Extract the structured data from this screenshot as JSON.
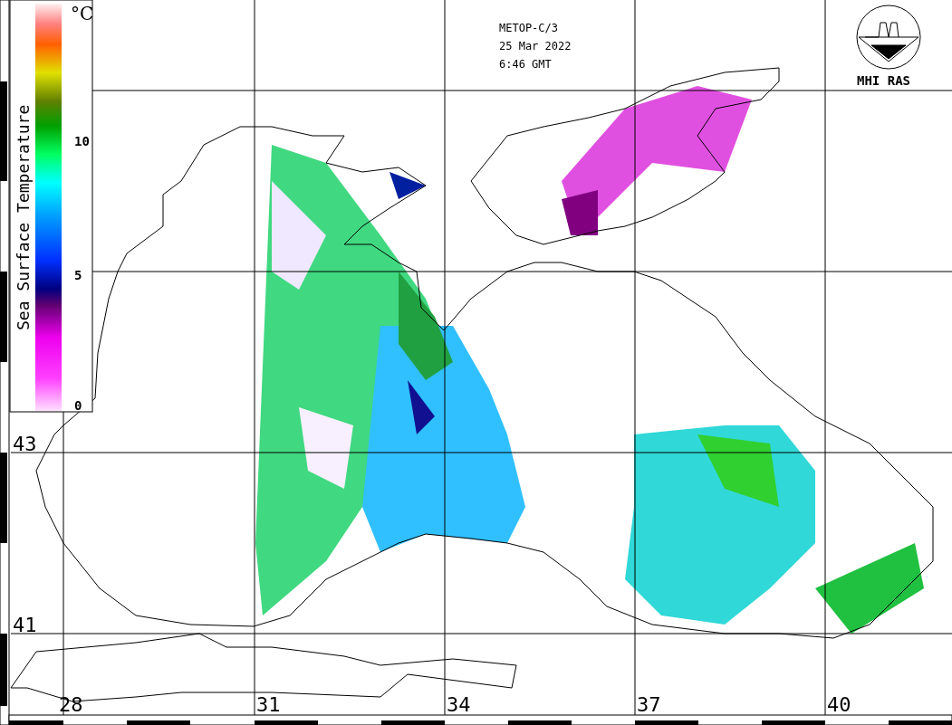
{
  "header": {
    "satellite": "METOP-C/3",
    "date": "25 Mar 2022",
    "time": "6:46 GMT"
  },
  "logo": {
    "caption": "MHI RAS"
  },
  "legend": {
    "title": "Sea Surface Temperature",
    "unit": "°C",
    "ticks": [
      "10",
      "5",
      "0"
    ]
  },
  "grid": {
    "latitude_labels": [
      "43",
      "41"
    ],
    "longitude_labels": [
      "28",
      "31",
      "34",
      "37",
      "40"
    ]
  }
}
